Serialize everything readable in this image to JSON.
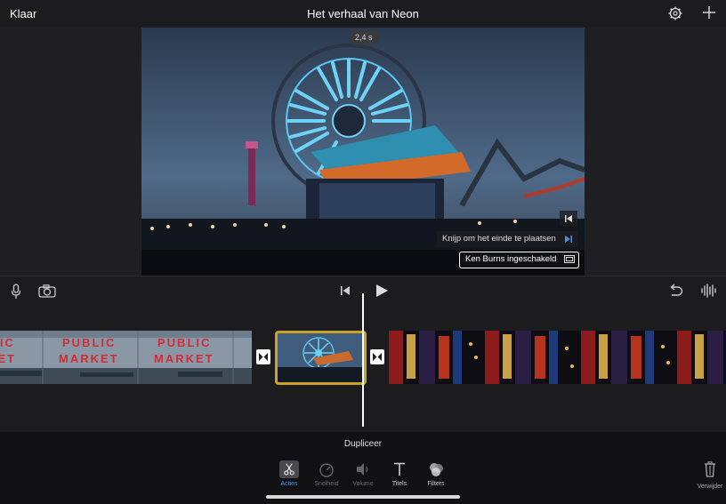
{
  "header": {
    "done_label": "Klaar",
    "title": "Het verhaal van Neon",
    "settings_icon": "gear-icon",
    "add_icon": "plus-icon"
  },
  "viewer": {
    "duration": "2,4 s",
    "hint": "Knijp om het einde te plaatsen",
    "ken_burns": "Ken Burns ingeschakeld"
  },
  "toolbar": {
    "mic_icon": "microphone-icon",
    "camera_icon": "camera-icon",
    "skip_back_icon": "skip-to-start-icon",
    "play_icon": "play-icon",
    "undo_icon": "undo-icon",
    "audio_icon": "waveform-icon"
  },
  "timeline": {
    "clips": [
      {
        "name": "public-market",
        "text": "PUBLIC MARKET"
      },
      {
        "name": "ferris-wheel",
        "selected": true
      },
      {
        "name": "neon-signs"
      }
    ]
  },
  "actions": {
    "current": "Dupliceer",
    "items": [
      {
        "label": "Acties",
        "icon": "scissors-icon",
        "active": true
      },
      {
        "label": "Snelheid",
        "icon": "speedometer-icon",
        "active": false
      },
      {
        "label": "Volume",
        "icon": "speaker-icon",
        "active": false
      },
      {
        "label": "Titels",
        "icon": "text-icon",
        "active": false
      },
      {
        "label": "Filters",
        "icon": "filters-icon",
        "active": false
      }
    ],
    "delete_label": "Verwijder"
  },
  "colors": {
    "accent": "#4a90e2",
    "selection": "#c9a227",
    "background": "#1c1c1e"
  }
}
